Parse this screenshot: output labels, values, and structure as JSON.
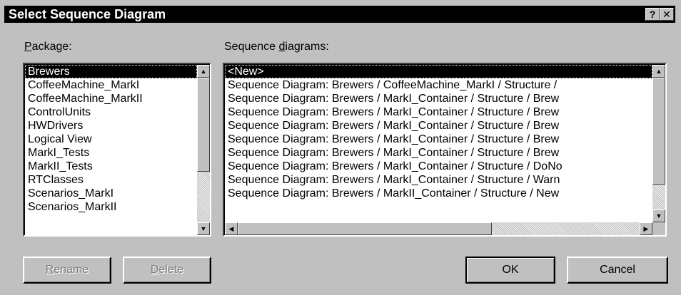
{
  "window": {
    "title": "Select Sequence Diagram",
    "help_glyph": "?",
    "close_glyph": "✕"
  },
  "package": {
    "label_prefix": "",
    "label_mnemonic": "P",
    "label_rest": "ackage:",
    "items": [
      "Brewers",
      "CoffeeMachine_MarkI",
      "CoffeeMachine_MarkII",
      "ControlUnits",
      "HWDrivers",
      "Logical View",
      "MarkI_Tests",
      "MarkII_Tests",
      "RTClasses",
      "Scenarios_MarkI",
      "Scenarios_MarkII"
    ],
    "selected_index": 0
  },
  "diagrams": {
    "label_prefix": "Sequence ",
    "label_mnemonic": "d",
    "label_rest": "iagrams:",
    "items": [
      "<New>",
      "Sequence Diagram: Brewers / CoffeeMachine_MarkI / Structure /",
      "Sequence Diagram: Brewers / MarkI_Container / Structure / Brew",
      "Sequence Diagram: Brewers / MarkI_Container / Structure / Brew",
      "Sequence Diagram: Brewers / MarkI_Container / Structure / Brew",
      "Sequence Diagram: Brewers / MarkI_Container / Structure / Brew",
      "Sequence Diagram: Brewers / MarkI_Container / Structure / Brew",
      "Sequence Diagram: Brewers / MarkI_Container / Structure / DoNo",
      "Sequence Diagram: Brewers / MarkI_Container / Structure / Warn",
      "Sequence Diagram: Brewers / MarkII_Container / Structure / New"
    ],
    "selected_index": 0
  },
  "scroll": {
    "up_glyph": "▲",
    "down_glyph": "▼",
    "left_glyph": "◀",
    "right_glyph": "▶"
  },
  "buttons": {
    "rename_mnemonic": "R",
    "rename_rest": "ename",
    "delete_mnemonic": "D",
    "delete_rest": "elete",
    "ok": "OK",
    "cancel": "Cancel"
  }
}
